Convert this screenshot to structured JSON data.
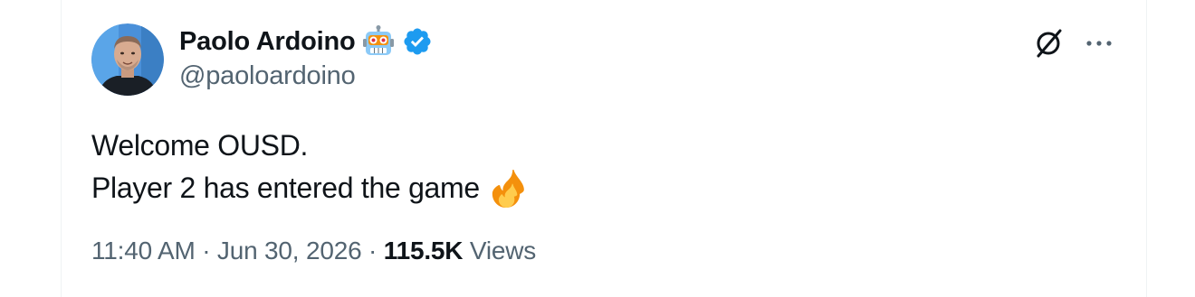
{
  "tweet": {
    "author_name": "Paolo Ardoino",
    "author_handle": "@paoloardoino",
    "name_emoji": "robot-face-emoji",
    "verified_badge": "verified-icon",
    "text_line1": "Welcome OUSD.",
    "text_line2": "Player 2 has entered the game",
    "text_emoji": "fire-emoji",
    "time": "11:40 AM",
    "separator": " · ",
    "date": "Jun 30, 2026",
    "views_count": "115.5K",
    "views_label": " Views"
  },
  "icons": {
    "grok": "grok-icon",
    "more": "more-icon"
  },
  "colors": {
    "text_primary": "#0f1419",
    "text_secondary": "#536471",
    "verified_blue": "#1d9bf0",
    "border": "#eff3f4"
  }
}
